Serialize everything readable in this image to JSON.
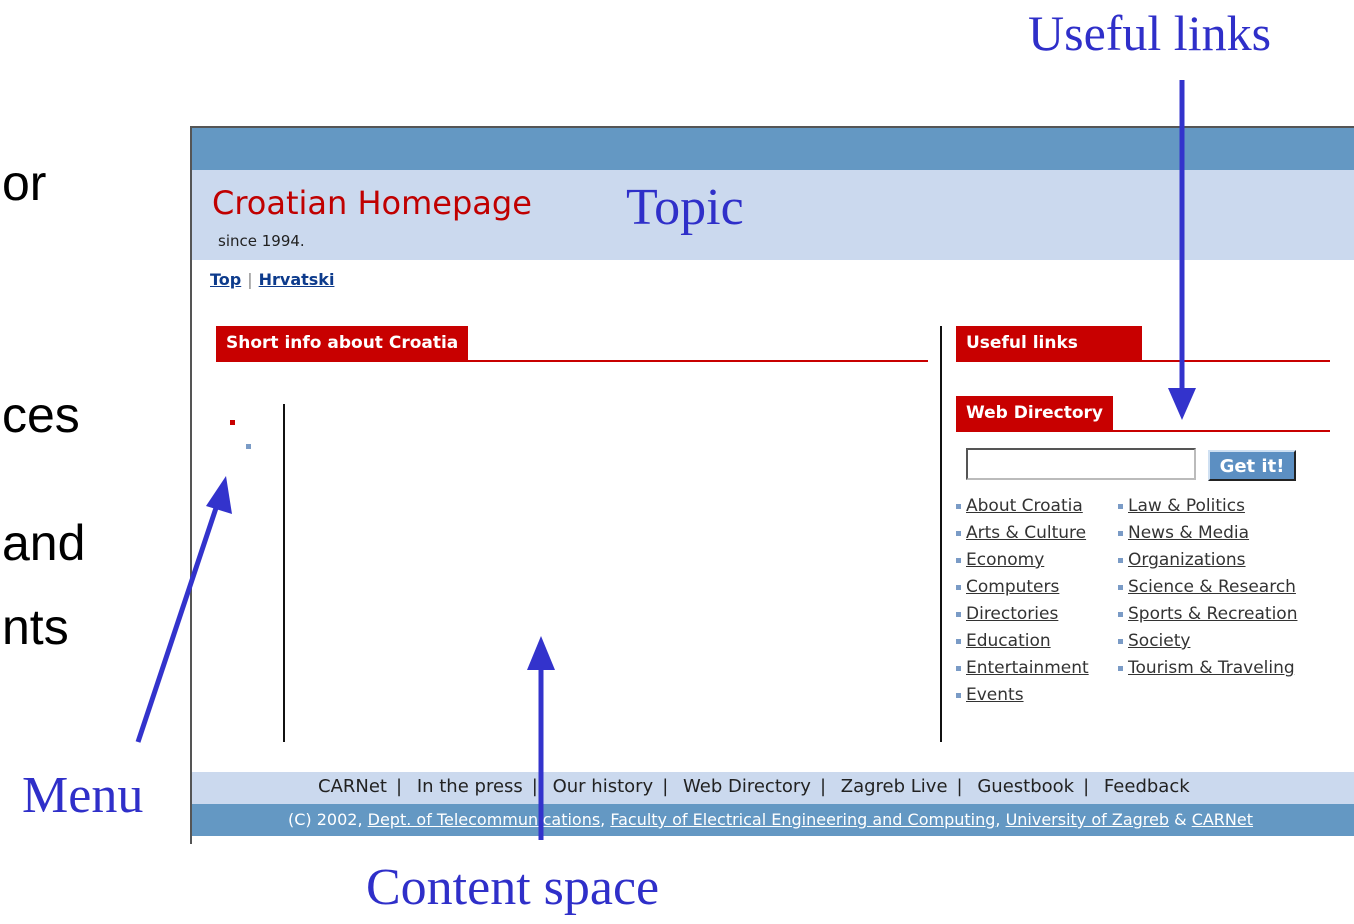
{
  "slide_fragments": [
    "or",
    "ces",
    "and",
    "nts"
  ],
  "annotations": {
    "useful_links": "Useful links",
    "topic": "Topic",
    "menu": "Menu",
    "content_space": "Content space",
    "arrow_color": "#3333cc"
  },
  "site": {
    "title": "Croatian Homepage",
    "since": "since 1994.",
    "title_color": "#c00000",
    "header_color": "#cbd9ee",
    "strip_color": "#6498c3"
  },
  "top_nav": {
    "top": "Top",
    "separator": "|",
    "hrvatski": "Hrvatski"
  },
  "main": {
    "short_info_tab": "Short info about Croatia"
  },
  "sidebar": {
    "useful_links_tab": "Useful links",
    "web_directory_tab": "Web Directory",
    "search_placeholder": "",
    "get_it": "Get it!",
    "directory_left": [
      "About Croatia",
      "Arts & Culture",
      "Economy",
      "Computers",
      "Directories",
      "Education",
      "Entertainment",
      "Events"
    ],
    "directory_right": [
      "Law & Politics",
      "News & Media",
      "Organizations",
      "Science & Research",
      "Sports & Recreation",
      "Society",
      "Tourism & Traveling"
    ]
  },
  "footer": {
    "nav": [
      "CARNet",
      "In the press",
      "Our history",
      "Web Directory",
      "Zagreb Live",
      "Guestbook",
      "Feedback"
    ],
    "copyright_prefix": "(C) 2002,",
    "dept": "Dept. of Telecommunications",
    "faculty": "Faculty of Electrical Engineering and Computing",
    "university": "University of Zagreb",
    "amp": "&",
    "carnet": "CARNet",
    "comma": ","
  }
}
